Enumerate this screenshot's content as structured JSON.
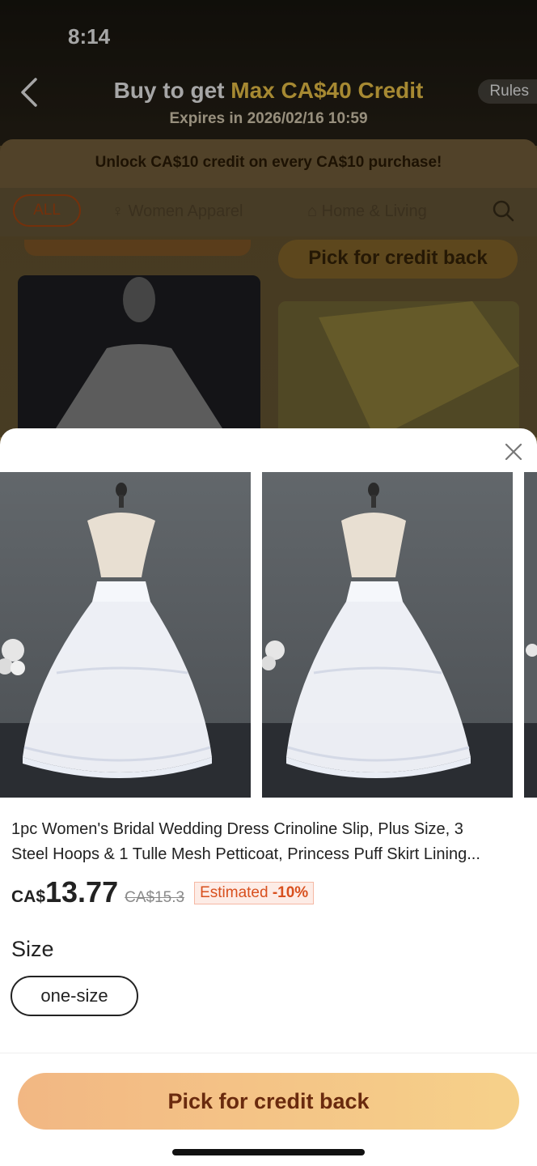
{
  "status_bar": {
    "time": "8:14"
  },
  "header": {
    "title_prefix": "Buy to get",
    "title_highlight": "Max CA$40 Credit",
    "expires": "Expires in 2026/02/16 10:59",
    "rules_label": "Rules"
  },
  "banner": {
    "text": "Unlock CA$10 credit on every CA$10 purchase!"
  },
  "categories": {
    "items": [
      {
        "label": "ALL"
      },
      {
        "label": "Women Apparel"
      },
      {
        "label": "Home & Living"
      }
    ]
  },
  "background_cta": {
    "label": "Pick for credit back"
  },
  "product": {
    "title_line1": "1pc Women's Bridal Wedding Dress Crinoline Slip, Plus Size, 3",
    "title_line2": "Steel Hoops & 1 Tulle Mesh Petticoat, Princess Puff Skirt Lining...",
    "currency": "CA$",
    "price": "13.77",
    "original_price": "CA$15.3",
    "estimated_label": "Estimated",
    "estimated_discount": "-10%"
  },
  "size": {
    "label": "Size",
    "options": [
      {
        "label": "one-size"
      }
    ]
  },
  "cta": {
    "label": "Pick for credit back"
  },
  "colors": {
    "accent": "#d8501e",
    "cta_start": "#f2b783",
    "cta_end": "#f6d18a"
  }
}
